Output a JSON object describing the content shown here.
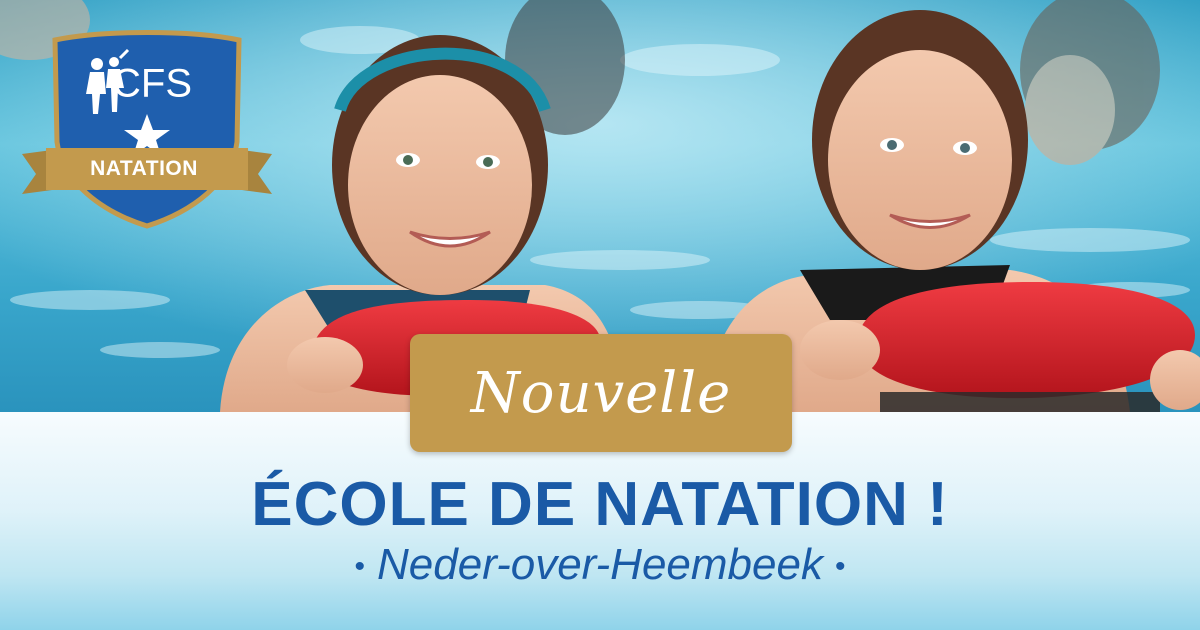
{
  "logo": {
    "brand": "CFS",
    "ribbon_label": "NATATION",
    "colors": {
      "shield": "#1f5fae",
      "gold": "#c39a4d"
    },
    "icons": [
      "athletes-icon",
      "star-icon"
    ]
  },
  "promo": {
    "ribbon_text": "Nouvelle",
    "headline": "ÉCOLE DE NATATION !",
    "location": "Neder-over-Heembeek",
    "bullet": "•"
  },
  "colors": {
    "headline_blue": "#1a5aa6",
    "ribbon_gold": "#c39a4d",
    "float_red": "#d81f2a"
  }
}
